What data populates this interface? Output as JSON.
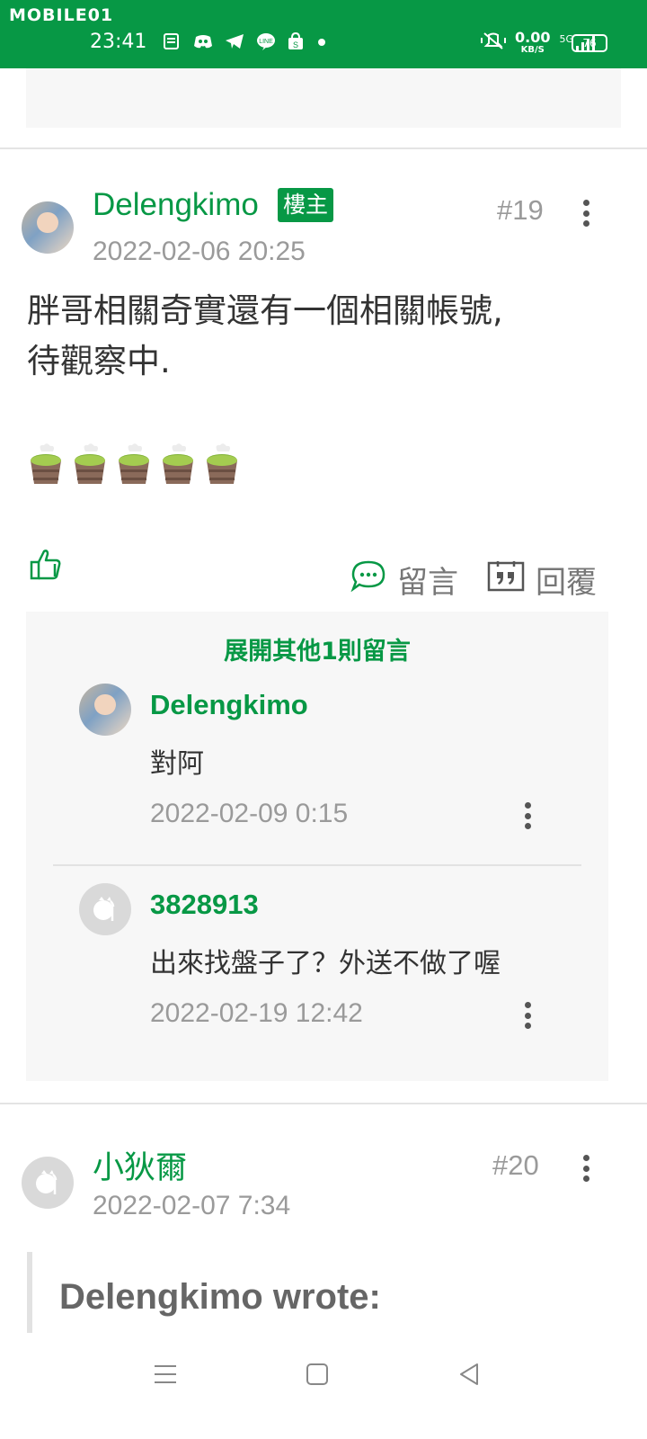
{
  "status_bar": {
    "brand": "MOBILE01",
    "time": "23:41",
    "notification_icons": [
      "news-icon",
      "discord-icon",
      "telegram-icon",
      "line-icon",
      "shopee-icon",
      "dot-icon"
    ],
    "speed_value": "0.00",
    "speed_unit": "KB/S",
    "network": "5G",
    "battery": "76",
    "bg_color": "#079845"
  },
  "post19": {
    "author": "Delengkimo",
    "badge": "樓主",
    "floor": "#19",
    "timestamp": "2022-02-06 20:25",
    "body_line1": "胖哥相關奇實還有一個相關帳號,",
    "body_line2": "待觀察中.",
    "emoji": "hot-spring-bucket-icon",
    "emoji_count": 5,
    "reply_comment_label": "留言",
    "reply_label": "回覆"
  },
  "comments": {
    "expand_label": "展開其他1則留言",
    "items": [
      {
        "author": "Delengkimo",
        "text": "對阿",
        "timestamp": "2022-02-09 0:15"
      },
      {
        "author": "3828913",
        "text": "出來找盤子了？外送不做了喔",
        "timestamp": "2022-02-19 12:42"
      }
    ]
  },
  "post20": {
    "author": "小狄爾",
    "floor": "#20",
    "timestamp": "2022-02-07 7:34",
    "quote": "Delengkimo wrote:"
  },
  "colors": {
    "accent": "#079845",
    "muted": "#9a9a9a",
    "panel": "#f7f7f7"
  }
}
